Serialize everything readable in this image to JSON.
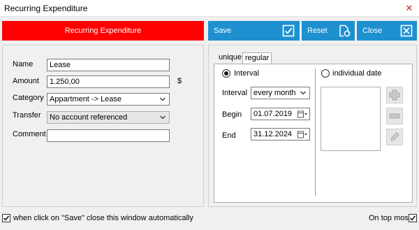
{
  "window": {
    "title": "Recurring Expenditure",
    "close_glyph": "✕"
  },
  "banner": {
    "label": "Recurring Expenditure",
    "color": "#ff0000"
  },
  "toolbar": {
    "accent": "#1e90d0",
    "save": {
      "label": "Save",
      "icon": "check-box-icon"
    },
    "reset": {
      "label": "Reset",
      "icon": "document-refresh-icon"
    },
    "close": {
      "label": "Close",
      "icon": "close-box-icon"
    }
  },
  "form": {
    "name": {
      "label": "Name",
      "value": "Lease"
    },
    "amount": {
      "label": "Amount",
      "value": "1.250,00",
      "unit": "$"
    },
    "category": {
      "label": "Category",
      "value": "Appartment -> Lease"
    },
    "transfer": {
      "label": "Transfer",
      "value": "No account referenced"
    },
    "comment": {
      "label": "Comment",
      "value": ""
    }
  },
  "tabs": [
    {
      "label": "unique",
      "active": false
    },
    {
      "label": "regular",
      "active": true
    }
  ],
  "regular": {
    "interval_radio": {
      "label": "Interval",
      "selected": true
    },
    "individual_radio": {
      "label": "individual date",
      "selected": false
    },
    "interval": {
      "label": "Interval",
      "value": "every month"
    },
    "begin": {
      "label": "Begin",
      "value": "01.07.2019"
    },
    "end": {
      "label": "End",
      "value": "31.12.2024"
    },
    "date_list": []
  },
  "footer": {
    "auto_close": {
      "label": "when click on \"Save\" close this window automatically",
      "checked": true
    },
    "on_top": {
      "label": "On top most",
      "checked": true
    }
  }
}
